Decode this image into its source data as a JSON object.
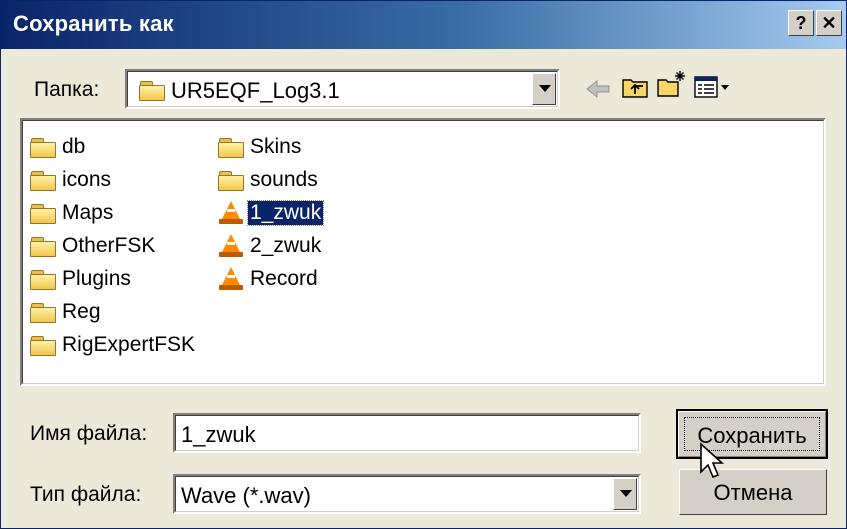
{
  "dialog": {
    "title": "Сохранить как",
    "help_glyph": "?",
    "close_glyph": "✕"
  },
  "folder_bar": {
    "label": "Папка:",
    "current_folder": "UR5EQF_Log3.1",
    "icons": [
      "back-arrow-icon",
      "up-folder-icon",
      "new-folder-icon",
      "view-menu-icon"
    ]
  },
  "files": {
    "column1": [
      {
        "name": "db",
        "icon": "folder-icon"
      },
      {
        "name": "icons",
        "icon": "folder-icon"
      },
      {
        "name": "Maps",
        "icon": "folder-icon"
      },
      {
        "name": "OtherFSK",
        "icon": "folder-icon"
      },
      {
        "name": "Plugins",
        "icon": "folder-icon"
      },
      {
        "name": "Reg",
        "icon": "folder-icon"
      },
      {
        "name": "RigExpertFSK",
        "icon": "folder-icon"
      }
    ],
    "column2": [
      {
        "name": "Skins",
        "icon": "folder-icon"
      },
      {
        "name": "sounds",
        "icon": "folder-icon"
      },
      {
        "name": "1_zwuk",
        "icon": "vlc-cone-icon",
        "selected": true
      },
      {
        "name": "2_zwuk",
        "icon": "vlc-cone-icon"
      },
      {
        "name": "Record",
        "icon": "vlc-cone-icon"
      }
    ]
  },
  "filename": {
    "label": "Имя файла:",
    "value": "1_zwuk"
  },
  "filetype": {
    "label": "Тип файла:",
    "value": "Wave (*.wav)"
  },
  "buttons": {
    "save": "Сохранить",
    "cancel": "Отмена"
  }
}
